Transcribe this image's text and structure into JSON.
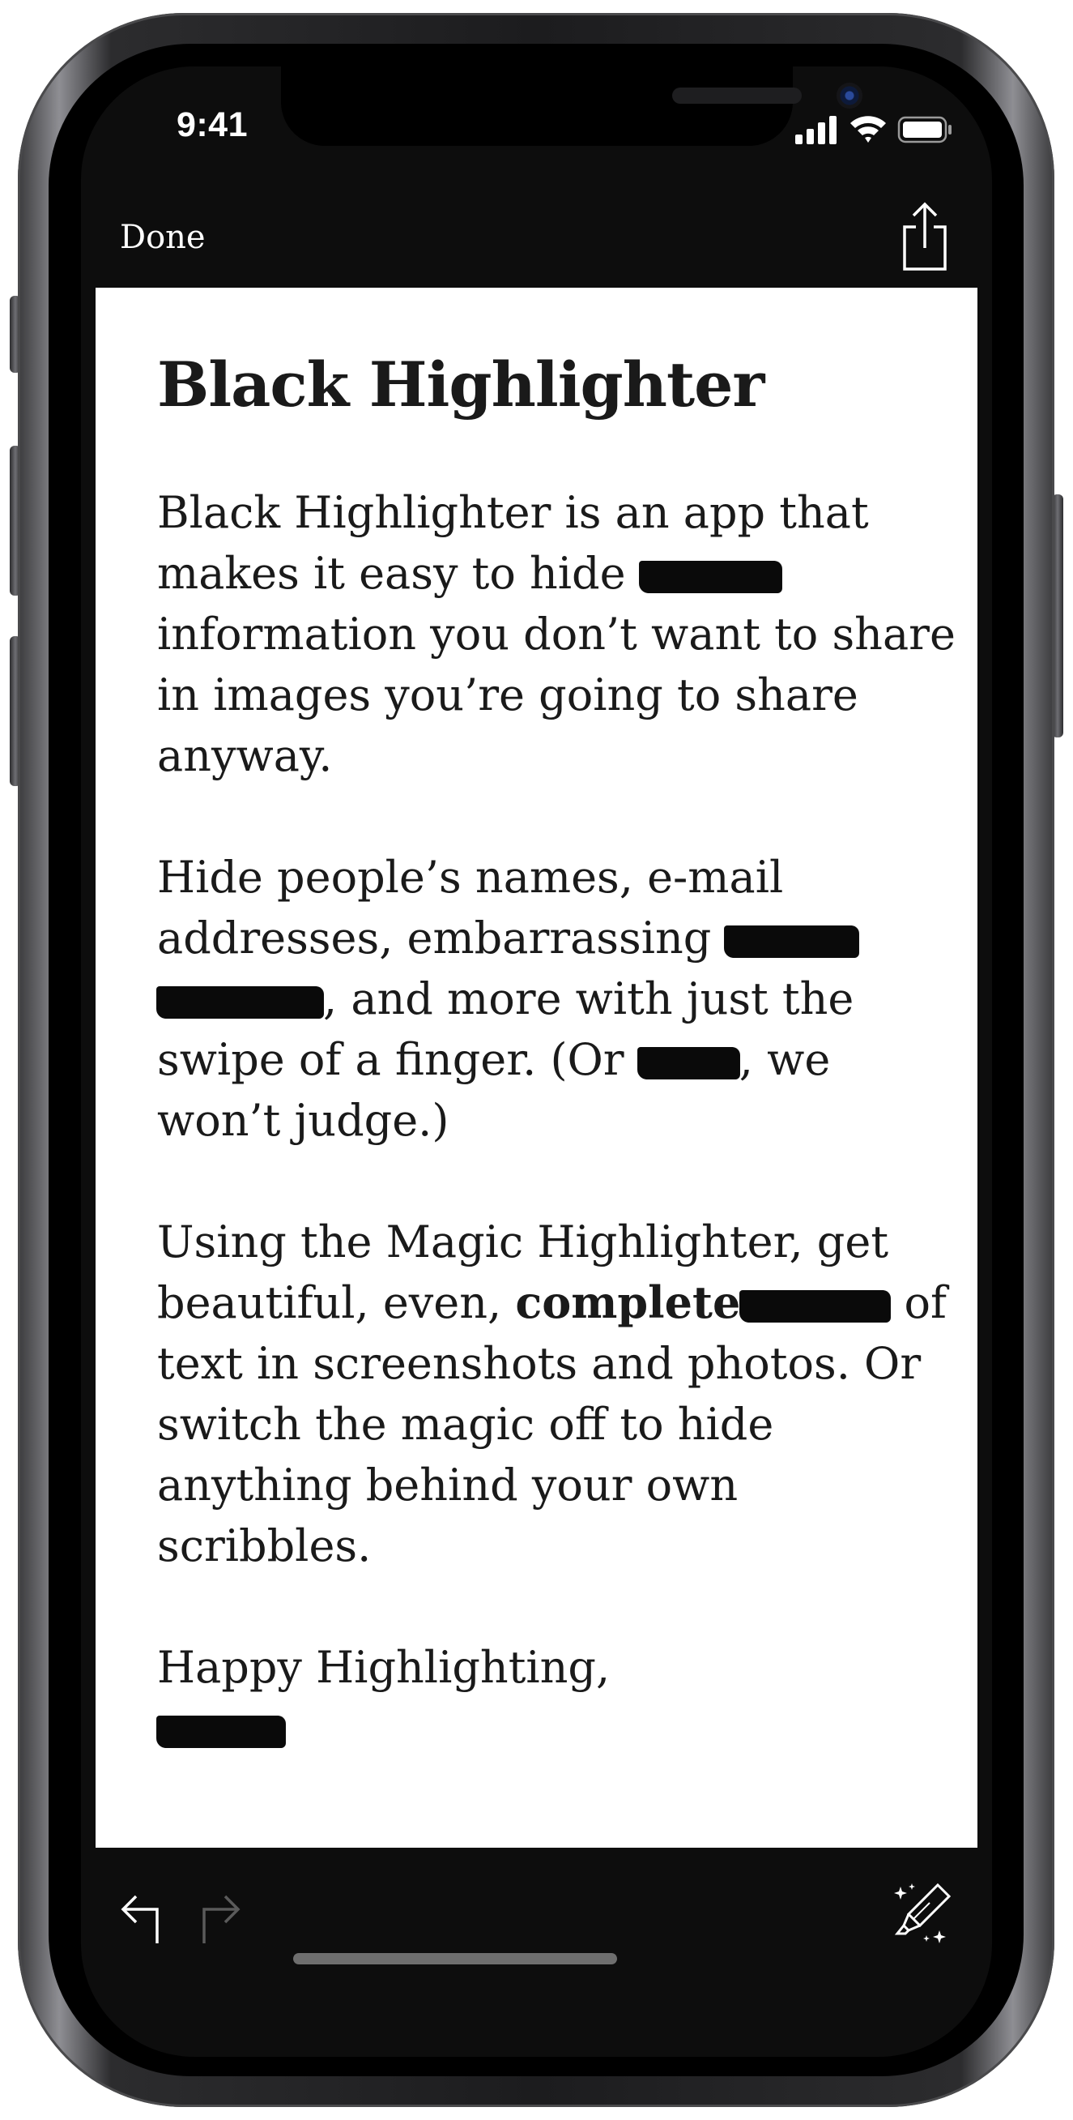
{
  "status_bar": {
    "time": "9:41",
    "signal_icon": "cellular-signal-icon",
    "wifi_icon": "wifi-icon",
    "battery_icon": "battery-icon"
  },
  "nav": {
    "done_label": "Done",
    "share_icon": "share-icon"
  },
  "document": {
    "title": "Black Highlighter",
    "paragraphs": [
      "Black Highlighter is an app that makes it easy to hide ▮ information you don’t want to share in images you’re going to share anyway.",
      "Hide people’s names, e-mail addresses, embarrassing ▮ ▮, and more with just the swipe of a finger. (Or ▮, we won’t judge.)",
      "Using the Magic Highlighter, get beautiful, even, complete ▮ of text in screenshots and photos. Or switch the magic off to hide anything behind your own scribbles.",
      "Happy Highlighting,"
    ],
    "p1": {
      "a": "Black Highlighter is an app that makes it easy to hide ",
      "b": " information you don’t want to share in images you’re going to share anyway."
    },
    "p2": {
      "a": "Hide people’s names, e-mail addresses, embarrassing ",
      "b": ", and more with just the swipe of a finger. (Or ",
      "c": ", we won’t judge.)"
    },
    "p3": {
      "a": "Using the Magic Highlighter, get beautiful, even, ",
      "bold": "complete",
      "b": " of text in screenshots and photos. Or switch the magic off to hide anything behind your own scribbles."
    },
    "p4": {
      "a": "Happy Highlighting,"
    },
    "redaction_color": "#0a0a0a"
  },
  "toolbar": {
    "undo_icon": "undo-arrow-icon",
    "redo_icon": "redo-arrow-icon",
    "marker_icon": "magic-highlighter-icon"
  }
}
